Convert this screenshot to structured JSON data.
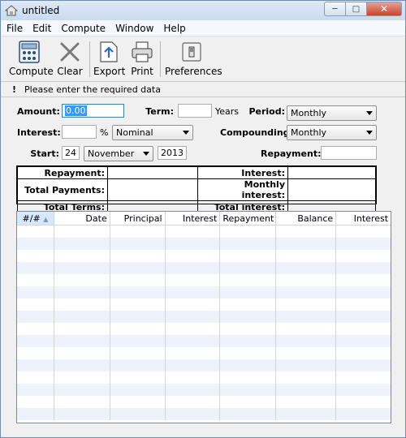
{
  "window": {
    "title": "untitled"
  },
  "menu": [
    "File",
    "Edit",
    "Compute",
    "Window",
    "Help"
  ],
  "toolbar": {
    "compute": "Compute",
    "clear": "Clear",
    "export": "Export",
    "print": "Print",
    "preferences": "Preferences"
  },
  "status": {
    "icon": "!",
    "message": "Please enter the required data"
  },
  "form": {
    "amount_label": "Amount:",
    "amount_value": "0.00",
    "term_label": "Term:",
    "term_value": "",
    "term_unit": "Years",
    "period_label": "Period:",
    "period_value": "Monthly",
    "interest_label": "Interest:",
    "interest_value": "",
    "interest_unit": "%",
    "interest_type": "Nominal",
    "compounding_label": "Compounding:",
    "compounding_value": "Monthly",
    "start_label": "Start:",
    "start_day": "24",
    "start_month": "November",
    "start_year": "2013",
    "repayment_label": "Repayment:",
    "repayment_value": ""
  },
  "summary": {
    "repayment": "Repayment:",
    "total_payments": "Total Payments:",
    "total_terms": "Total Terms:",
    "interest": "Interest:",
    "monthly_interest": "Monthly interest:",
    "total_interest": "Total interest:"
  },
  "table": {
    "columns": [
      "#/#",
      "Date",
      "Principal",
      "Interest",
      "Repayment",
      "Balance",
      "Interest"
    ],
    "rows": []
  }
}
